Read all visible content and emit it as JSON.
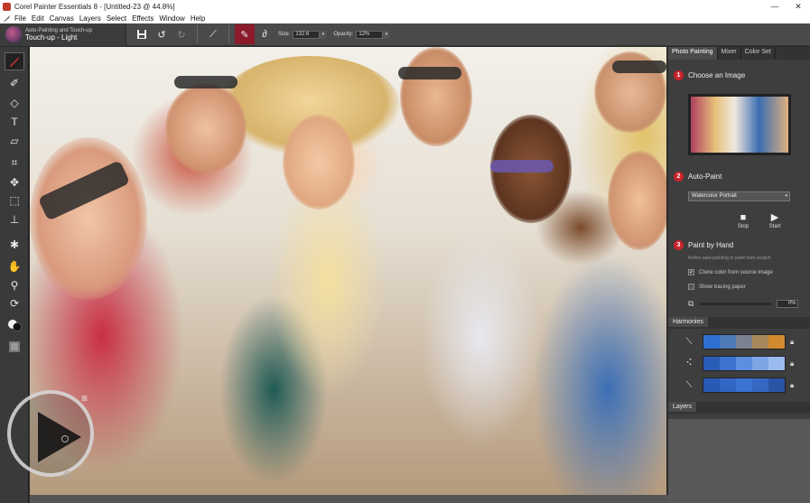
{
  "window": {
    "title": "Corel Painter Essentials 8 - [Untitled-23 @ 44.8%]",
    "minimize": "—",
    "close": "✕"
  },
  "menu": [
    "File",
    "Edit",
    "Canvas",
    "Layers",
    "Select",
    "Effects",
    "Window",
    "Help"
  ],
  "property_bar": {
    "brush_category": "Auto-Painting and Touch-up",
    "brush_variant": "Touch-up - Light",
    "size_label": "Size:",
    "size_value": "132.6",
    "opacity_label": "Opacity:",
    "opacity_value": "12%"
  },
  "panel": {
    "tabs": [
      "Photo Painting",
      "Mixer",
      "Color Set"
    ],
    "step1": {
      "num": "1",
      "label": "Choose an Image"
    },
    "step2": {
      "num": "2",
      "label": "Auto-Paint"
    },
    "auto_paint_style": "Watercolor Portrait",
    "stop_label": "Stop",
    "start_label": "Start",
    "step3": {
      "num": "3",
      "label": "Paint by Hand"
    },
    "hint": "Refine auto-painting or paint from scratch",
    "clone_color_label": "Clone color from source image",
    "clone_color_checked": true,
    "tracing_paper_label": "Show tracing paper",
    "tracing_paper_checked": false,
    "slider_value": "0%",
    "harmonies_tab": "Harmonies",
    "layers_tab": "Layers",
    "harmonies": [
      {
        "icon": "complementary-harmony-icon",
        "colors": [
          "#2f6fd1",
          "#4d7ab8",
          "#7a8190",
          "#a8875a",
          "#d28a2e"
        ]
      },
      {
        "icon": "analogous-harmony-icon",
        "colors": [
          "#2a5db8",
          "#3e72cf",
          "#5d8ee0",
          "#7ea5e6",
          "#9bbbf0"
        ]
      },
      {
        "icon": "monochrome-harmony-icon",
        "colors": [
          "#2759b5",
          "#3266c4",
          "#3a73d3",
          "#3568c2",
          "#2a55a6"
        ]
      }
    ]
  },
  "icons": {
    "play_overlay": "play-icon",
    "menu_overlay": "hamburger-icon"
  }
}
